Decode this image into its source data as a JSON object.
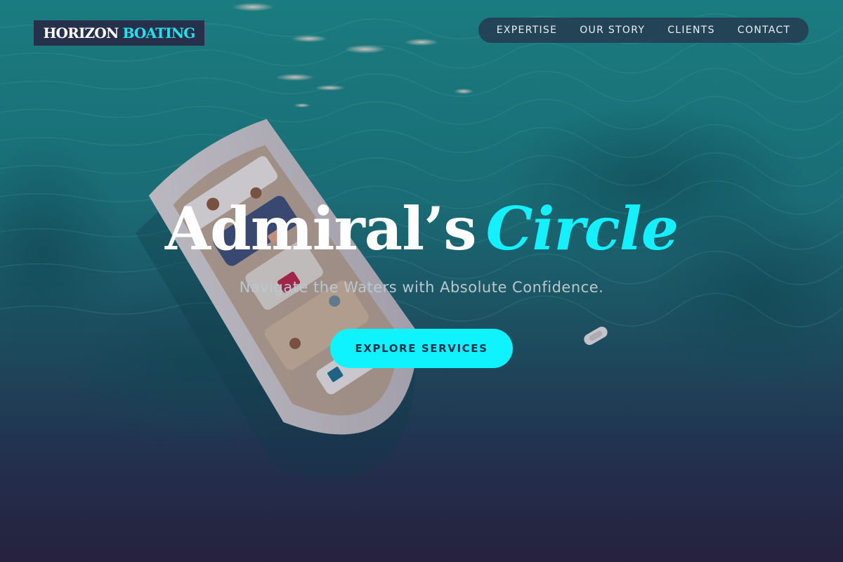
{
  "brand": {
    "name_part1": "HORIZON",
    "name_part2": "BOATING"
  },
  "nav": {
    "items": [
      {
        "label": "EXPERTISE"
      },
      {
        "label": "OUR STORY"
      },
      {
        "label": "CLIENTS"
      },
      {
        "label": "CONTACT"
      }
    ]
  },
  "hero": {
    "title_main": "Admiral’s",
    "title_accent": "Circle",
    "subtitle": "Navigate the Waters with Absolute Confidence.",
    "cta_label": "EXPLORE SERVICES",
    "background_image": "aerial-speedboat-on-turquoise-sea"
  },
  "colors": {
    "accent": "#0ef3ff",
    "logo_bg": "#27304a",
    "nav_bg": "#26384e",
    "sea_top": "#1d8a8c",
    "sea_bottom": "#27233f"
  }
}
